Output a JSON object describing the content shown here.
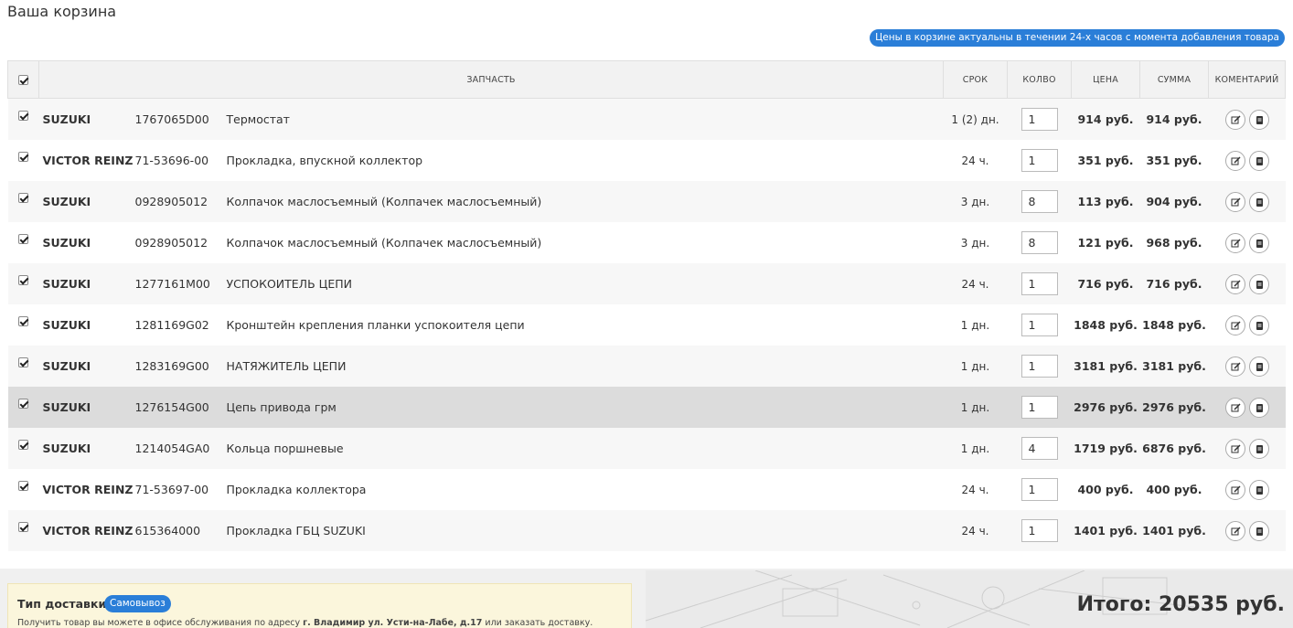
{
  "page_title": "Ваша корзина",
  "notice": "Цены в корзине актуальны в течении 24-х часов с момента добавления товара",
  "table": {
    "headers": {
      "part": "ЗАПЧАСТЬ",
      "term": "СРОК",
      "qty": "КОЛВО",
      "price": "ЦЕНА",
      "sum": "СУММА",
      "comment": "КОМЕНТАРИЙ"
    },
    "rows": [
      {
        "brand": "SUZUKI",
        "article": "1767065D00",
        "name": "Термостат",
        "term": "1 (2) дн.",
        "qty": "1",
        "price": "914 руб.",
        "sum": "914 руб."
      },
      {
        "brand": "VICTOR REINZ",
        "article": "71-53696-00",
        "name": "Прокладка, впускной коллектор",
        "term": "24 ч.",
        "qty": "1",
        "price": "351 руб.",
        "sum": "351 руб."
      },
      {
        "brand": "SUZUKI",
        "article": "0928905012",
        "name": "Колпачок маслосъемный (Колпачек маслосъемный)",
        "term": "3 дн.",
        "qty": "8",
        "price": "113 руб.",
        "sum": "904 руб."
      },
      {
        "brand": "SUZUKI",
        "article": "0928905012",
        "name": "Колпачок маслосъемный (Колпачек маслосъемный)",
        "term": "3 дн.",
        "qty": "8",
        "price": "121 руб.",
        "sum": "968 руб."
      },
      {
        "brand": "SUZUKI",
        "article": "1277161M00",
        "name": "УСПОКОИТЕЛЬ ЦЕПИ",
        "term": "24 ч.",
        "qty": "1",
        "price": "716 руб.",
        "sum": "716 руб."
      },
      {
        "brand": "SUZUKI",
        "article": "1281169G02",
        "name": "Кронштейн крепления планки успокоителя цепи",
        "term": "1 дн.",
        "qty": "1",
        "price": "1848 руб.",
        "sum": "1848 руб."
      },
      {
        "brand": "SUZUKI",
        "article": "1283169G00",
        "name": "НАТЯЖИТЕЛЬ ЦЕПИ",
        "term": "1 дн.",
        "qty": "1",
        "price": "3181 руб.",
        "sum": "3181 руб."
      },
      {
        "brand": "SUZUKI",
        "article": "1276154G00",
        "name": "Цепь привода грм",
        "term": "1 дн.",
        "qty": "1",
        "price": "2976 руб.",
        "sum": "2976 руб."
      },
      {
        "brand": "SUZUKI",
        "article": "1214054GA0",
        "name": "Кольца поршневые",
        "term": "1 дн.",
        "qty": "4",
        "price": "1719 руб.",
        "sum": "6876 руб."
      },
      {
        "brand": "VICTOR REINZ",
        "article": "71-53697-00",
        "name": "Прокладка коллектора",
        "term": "24 ч.",
        "qty": "1",
        "price": "400 руб.",
        "sum": "400 руб."
      },
      {
        "brand": "VICTOR REINZ",
        "article": "615364000",
        "name": "Прокладка ГБЦ SUZUKI",
        "term": "24 ч.",
        "qty": "1",
        "price": "1401 руб.",
        "sum": "1401 руб."
      }
    ]
  },
  "delivery": {
    "label": "Тип доставки:",
    "type": "Самовывоз",
    "note_prefix": "Получить товар вы можете в офисе обслуживания по адресу",
    "address": "г. Владимир ул. Усти-на-Лабе, д.17",
    "note_suffix": "или заказать доставку."
  },
  "total": "Итого: 20535 руб.",
  "colors": {
    "accent": "#2a7ed8",
    "highlight_row": "#dcdcdc"
  },
  "icons": {
    "edit": "edit-comment-icon",
    "note": "comment-book-icon"
  }
}
